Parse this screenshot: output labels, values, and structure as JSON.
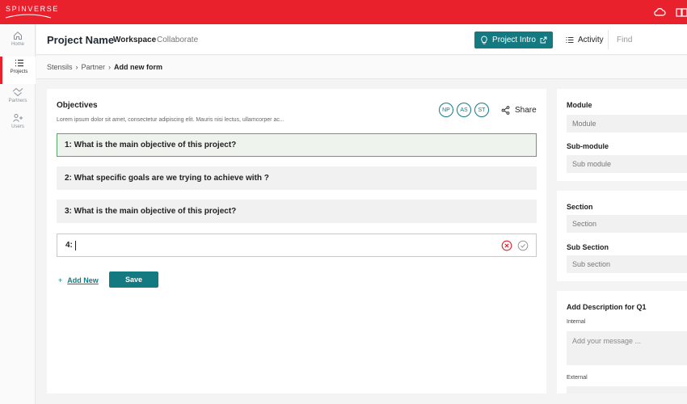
{
  "app": {
    "logo_text": "SPINVERSE",
    "brand_color": "#e8212d",
    "accent_color": "#137a82"
  },
  "topbar_icons": [
    "cloud-icon",
    "book-icon"
  ],
  "sidebar": {
    "items": [
      {
        "label": "Home",
        "icon": "home-icon",
        "active": false
      },
      {
        "label": "Projects",
        "icon": "list-icon",
        "active": true
      },
      {
        "label": "Partners",
        "icon": "handshake-icon",
        "active": false
      },
      {
        "label": "Users",
        "icon": "users-icon",
        "active": false
      }
    ]
  },
  "header": {
    "project_name": "Project Name",
    "tabs": [
      {
        "label": "Workspace",
        "active": true
      },
      {
        "label": "Collaborate",
        "active": false
      }
    ],
    "intro_button": "Project Intro",
    "activity_label": "Activity",
    "find_placeholder": "Find"
  },
  "breadcrumb": {
    "items": [
      "Stensils",
      "Partner"
    ],
    "current": "Add new form"
  },
  "objectives": {
    "title": "Objectives",
    "description": "Lorem ipsum dolor sit amet, consectetur adipiscing elit. Mauris nisi lectus, ullamcorper ac...",
    "avatars": [
      "NP",
      "AS",
      "ST"
    ],
    "share_label": "Share",
    "questions": [
      {
        "text": "1: What is the main objective of this project?",
        "selected": true
      },
      {
        "text": "2: What specific goals are we trying to achieve with ?",
        "selected": false
      },
      {
        "text": "3: What is the main objective of this project?",
        "selected": false
      }
    ],
    "new_question": {
      "number": "4:",
      "value": ""
    },
    "add_new_label": "Add New",
    "save_label": "Save"
  },
  "right_panel": {
    "module": {
      "label": "Module",
      "placeholder": "Module"
    },
    "submodule": {
      "label": "Sub-module",
      "placeholder": "Sub module"
    },
    "section": {
      "label": "Section",
      "placeholder": "Section"
    },
    "subsection": {
      "label": "Sub Section",
      "placeholder": "Sub section"
    },
    "description": {
      "title": "Add Description for Q1",
      "internal_label": "Internal",
      "internal_placeholder": "Add your message ...",
      "external_label": "External"
    }
  }
}
